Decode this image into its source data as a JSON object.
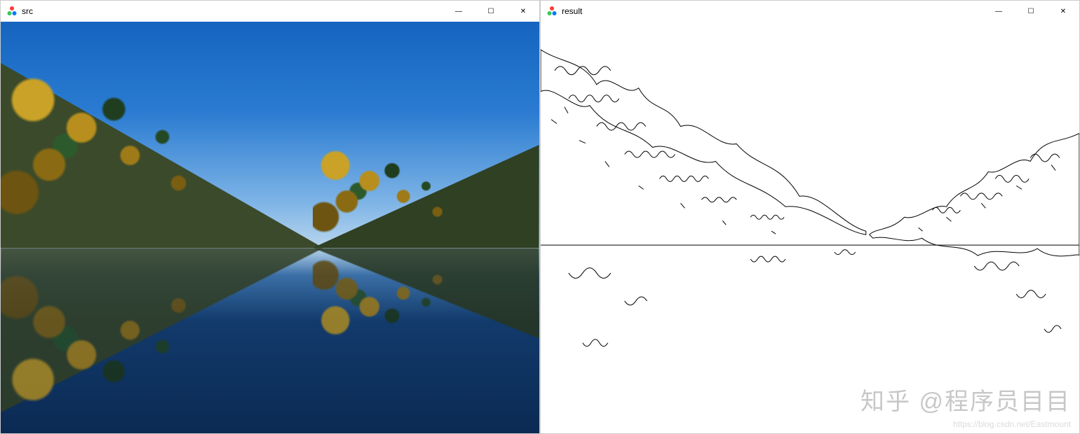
{
  "windows": {
    "src": {
      "title": "src",
      "icon": "opencv-icon",
      "controls": {
        "minimize_glyph": "—",
        "maximize_glyph": "☐",
        "close_glyph": "✕"
      },
      "image_description": "Landscape photo: blue sky, autumn trees on both banks, calm lake with mirror reflection"
    },
    "result": {
      "title": "result",
      "icon": "opencv-icon",
      "controls": {
        "minimize_glyph": "—",
        "maximize_glyph": "☐",
        "close_glyph": "✕"
      },
      "image_description": "Edge-detection output of the src image: black contour lines on white background"
    }
  },
  "watermark": {
    "main": "知乎 @程序员目目",
    "sub": "https://blog.csdn.net/Eastmount"
  },
  "colors": {
    "sky_top": "#1565c0",
    "sky_bottom": "#b8d6ee",
    "water_deep": "#0b2a53",
    "foliage_warm": "#c9a227",
    "foliage_dark": "#1f3d1f",
    "edge_stroke": "#000000",
    "edge_bg": "#ffffff"
  }
}
